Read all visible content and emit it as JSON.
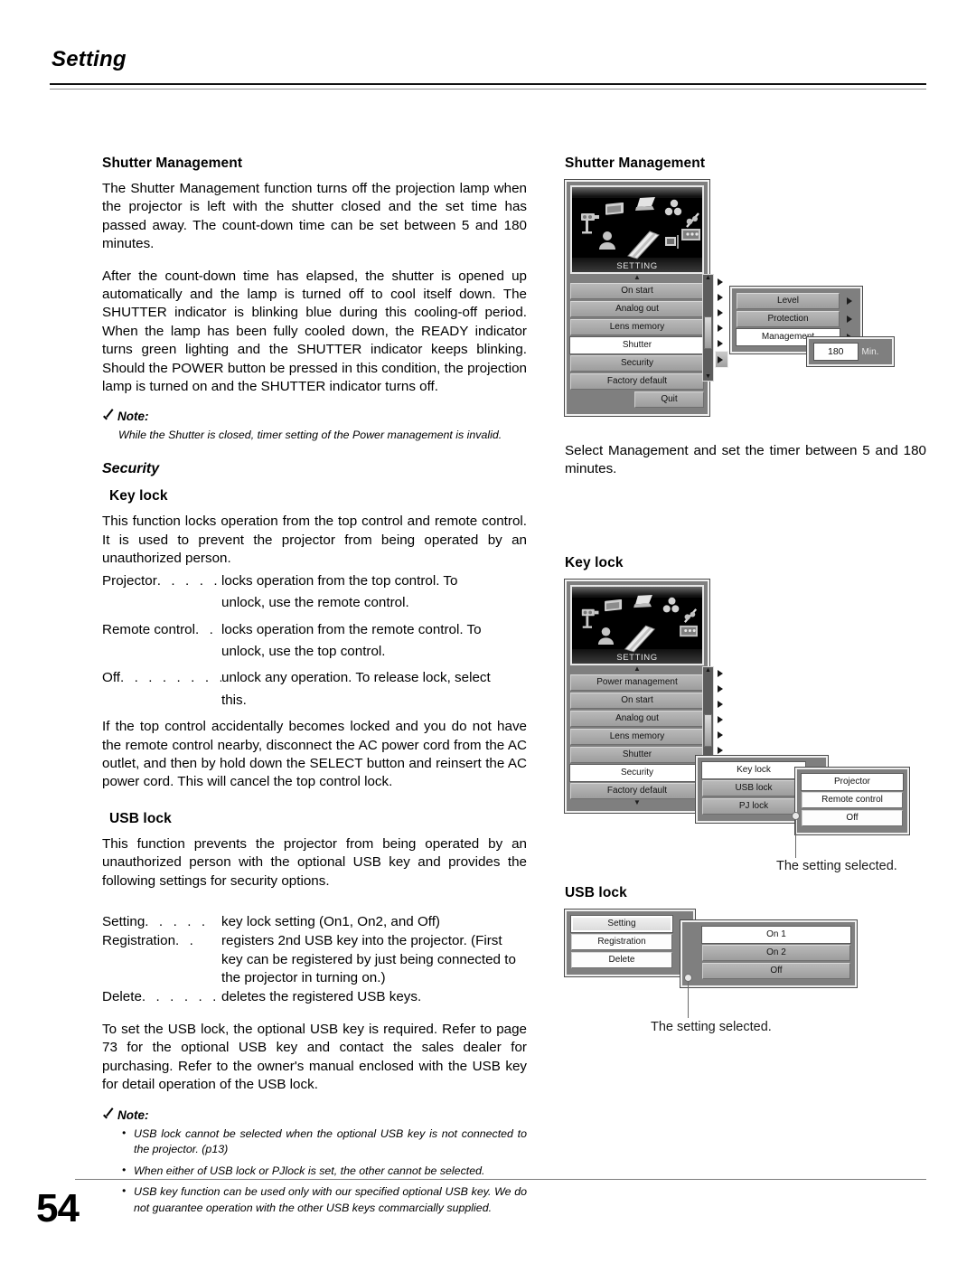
{
  "running_head": "Setting",
  "page_number": "54",
  "left_column": {
    "shutter_management": {
      "heading": "Shutter Management",
      "paragraphs": [
        "The Shutter Management function turns off the projection lamp when the projector is left with the shutter closed and the set time has passed away. The count-down time can be set between 5 and 180 minutes.",
        "After the count-down time has elapsed, the shutter is opened up automatically and the lamp is turned off to cool itself down. The SHUTTER indicator is blinking blue during this cooling-off period. When the lamp has been fully cooled down, the READY indicator turns green lighting and the SHUTTER indicator keeps blinking. Should the POWER button be pressed in this condition, the projection lamp is turned on and the SHUTTER indicator turns off."
      ],
      "note": {
        "label": "Note:",
        "text": "While the Shutter is closed, timer setting of the Power management is invalid."
      }
    },
    "security": {
      "heading": "Security",
      "key_lock": {
        "heading": "Key lock",
        "intro": "This function locks operation from the top control and remote control.  It is used to prevent the projector from being operated by an unauthorized person.",
        "options": [
          {
            "term": "Projector",
            "dots": ". . . . . .",
            "desc": "locks operation from the top control. To",
            "cont": "unlock, use the remote control."
          },
          {
            "term": "Remote control",
            "dots": ". .",
            "desc": "locks operation from the remote control. To",
            "cont": "unlock, use the top control."
          },
          {
            "term": "Off",
            "dots": ". . . . . . . . . .",
            "desc": "unlock any operation. To release lock, select",
            "cont": "this."
          }
        ],
        "outro": "If the top control accidentally becomes locked and you do not have the remote control nearby, disconnect the AC power cord from the AC outlet, and then by hold down the SELECT button and reinsert the AC power cord. This will cancel the top control lock."
      },
      "usb_lock": {
        "heading": "USB lock",
        "intro": "This function prevents the projector from being operated by an unauthorized person with the optional USB key and provides the following settings for security options.",
        "options": [
          {
            "term": "Setting",
            "dots": ". . . . .",
            "desc": "key lock setting (On1, On2, and Off)",
            "cont": ""
          },
          {
            "term": "Registration",
            "dots": ". .",
            "desc": "registers 2nd USB key into the projector. (First",
            "cont": "key can be registered by just being connected to the projector in turning on.)"
          },
          {
            "term": "Delete",
            "dots": ". . . . . .",
            "desc": "deletes the registered USB keys.",
            "cont": ""
          }
        ],
        "outro": "To set the USB lock, the optional USB key is required. Refer to page 73  for the optional USB key and contact the sales dealer for purchasing. Refer to the owner's manual enclosed with the USB key for detail operation of the USB  lock.",
        "note": {
          "label": "Note:",
          "items": [
            "USB lock cannot be selected when the optional USB key is not connected to the projector. (p13)",
            "When either of USB lock or PJlock is set, the other cannot be selected.",
            "USB key function can be used only with our specified optional USB key. We do not guarantee operation with the other USB keys commarcially supplied."
          ]
        }
      }
    }
  },
  "right_column": {
    "shutter_management_figure": {
      "heading": "Shutter Management",
      "osd": {
        "icon_panel_label": "SETTING",
        "menu_items": [
          {
            "label": "On start",
            "selected": false,
            "arrow": true
          },
          {
            "label": "Analog out",
            "selected": false,
            "arrow": true
          },
          {
            "label": "Lens memory",
            "selected": false,
            "arrow": true
          },
          {
            "label": "Shutter",
            "selected": true,
            "arrow": true
          },
          {
            "label": "Security",
            "selected": false,
            "arrow": true
          },
          {
            "label": "Factory default",
            "selected": false,
            "arrow": true
          }
        ],
        "quit_label": "Quit",
        "submenu": [
          {
            "label": "Level",
            "selected": false
          },
          {
            "label": "Protection",
            "selected": false
          },
          {
            "label": "Management",
            "selected": true
          }
        ],
        "value": "180",
        "value_unit": "Min."
      },
      "caption": "Select Management and set the timer between 5 and 180 minutes."
    },
    "key_lock_figure": {
      "heading": "Key lock",
      "osd": {
        "icon_panel_label": "SETTING",
        "menu_items": [
          {
            "label": "Power management",
            "selected": false,
            "arrow": true
          },
          {
            "label": "On start",
            "selected": false,
            "arrow": true
          },
          {
            "label": "Analog out",
            "selected": false,
            "arrow": true
          },
          {
            "label": "Lens memory",
            "selected": false,
            "arrow": true
          },
          {
            "label": "Shutter",
            "selected": false,
            "arrow": true
          },
          {
            "label": "Security",
            "selected": true,
            "arrow": true
          },
          {
            "label": "Factory default",
            "selected": false,
            "arrow": true
          }
        ],
        "submenu": [
          {
            "label": "Key lock",
            "selected": true
          },
          {
            "label": "USB lock",
            "selected": false
          },
          {
            "label": "PJ lock",
            "selected": false
          }
        ],
        "options": [
          {
            "label": "Projector",
            "selected": true
          },
          {
            "label": "Remote control",
            "selected": false
          },
          {
            "label": "Off",
            "selected": false
          }
        ]
      },
      "callout": "The setting selected."
    },
    "usb_lock_figure": {
      "heading": "USB lock",
      "osd": {
        "menu_items": [
          {
            "label": "Setting",
            "selected": true,
            "arrow": true
          },
          {
            "label": "Registration",
            "selected": false,
            "arrow": false
          },
          {
            "label": "Delete",
            "selected": false,
            "arrow": true
          }
        ],
        "options": [
          {
            "label": "On 1",
            "selected": true
          },
          {
            "label": "On 2",
            "selected": false
          },
          {
            "label": "Off",
            "selected": false
          }
        ]
      },
      "callout": "The setting selected."
    }
  }
}
